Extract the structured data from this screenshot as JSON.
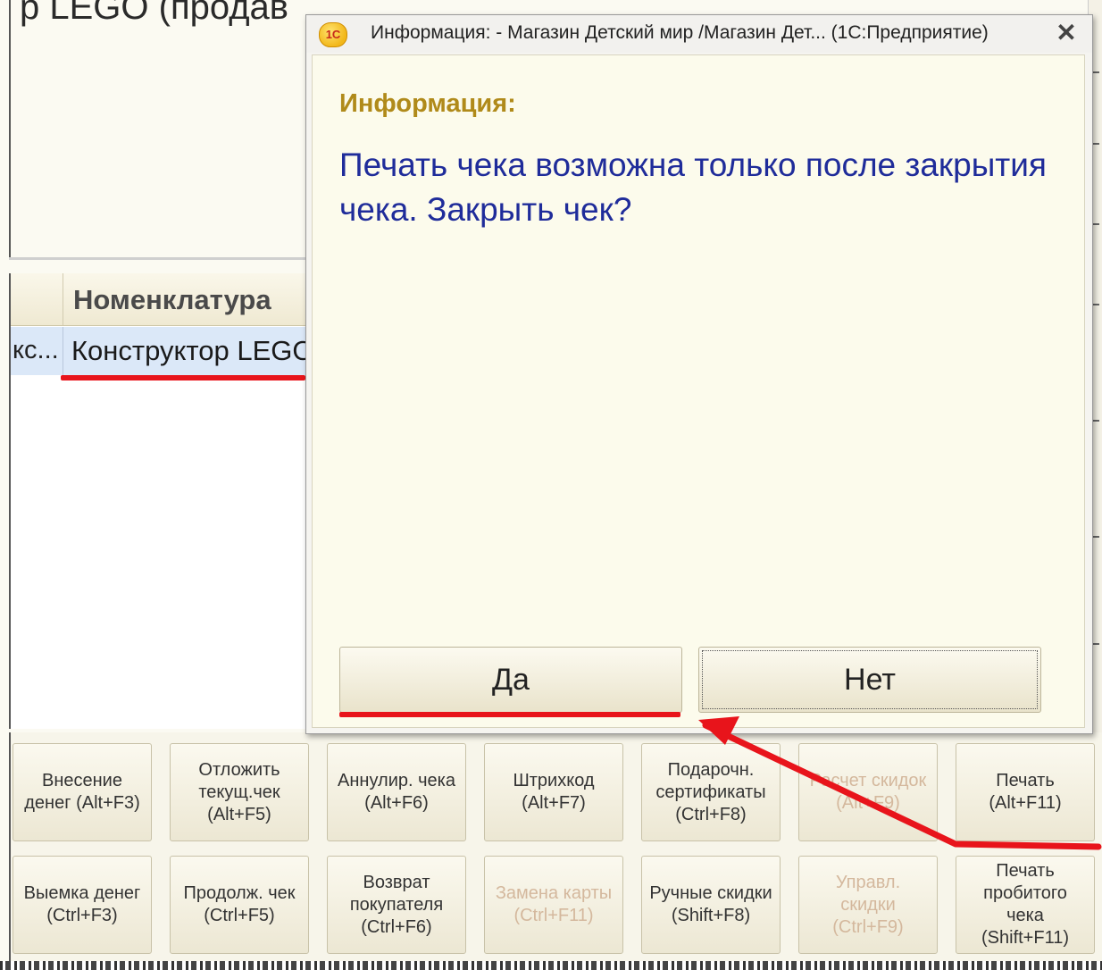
{
  "background_window": {
    "title_fragment": "р LEGO (продав"
  },
  "grid": {
    "column_header": "Номенклатура",
    "row": {
      "col_a": "кс...",
      "col_b": "Конструктор LEGO"
    }
  },
  "dialog": {
    "title": "Информация: - Магазин Детский мир /Магазин Дет... (1С:Предприятие)",
    "app_icon_label": "1С",
    "heading": "Информация:",
    "message": "Печать чека возможна только после закрытия чека. Закрыть чек?",
    "yes_label": "Да",
    "no_label": "Нет"
  },
  "toolbar": {
    "row1": [
      {
        "label": "Внесение\nденег (Alt+F3)",
        "enabled": true
      },
      {
        "label": "Отложить\nтекущ.чек\n(Alt+F5)",
        "enabled": true
      },
      {
        "label": "Аннулир. чека\n(Alt+F6)",
        "enabled": true
      },
      {
        "label": "Штрихкод\n(Alt+F7)",
        "enabled": true
      },
      {
        "label": "Подарочн.\nсертификаты\n(Ctrl+F8)",
        "enabled": true
      },
      {
        "label": "Расчет скидок\n(Alt+F9)",
        "enabled": false
      },
      {
        "label": "Печать\n(Alt+F11)",
        "enabled": true
      }
    ],
    "row2": [
      {
        "label": "Выемка денег\n(Ctrl+F3)",
        "enabled": true
      },
      {
        "label": "Продолж. чек\n(Ctrl+F5)",
        "enabled": true
      },
      {
        "label": "Возврат\nпокупателя\n(Ctrl+F6)",
        "enabled": true
      },
      {
        "label": "Замена карты\n(Ctrl+F11)",
        "enabled": false
      },
      {
        "label": "Ручные скидки\n(Shift+F8)",
        "enabled": true
      },
      {
        "label": "Управл.\nскидки\n(Ctrl+F9)",
        "enabled": false
      },
      {
        "label": "Печать\nпробитого\nчека\n(Shift+F11)",
        "enabled": true
      }
    ]
  },
  "colors": {
    "annotation_red": "#e8141b",
    "heading_gold": "#b08a1a",
    "message_blue": "#1f2c9a",
    "disabled_text": "#d4b89d"
  }
}
